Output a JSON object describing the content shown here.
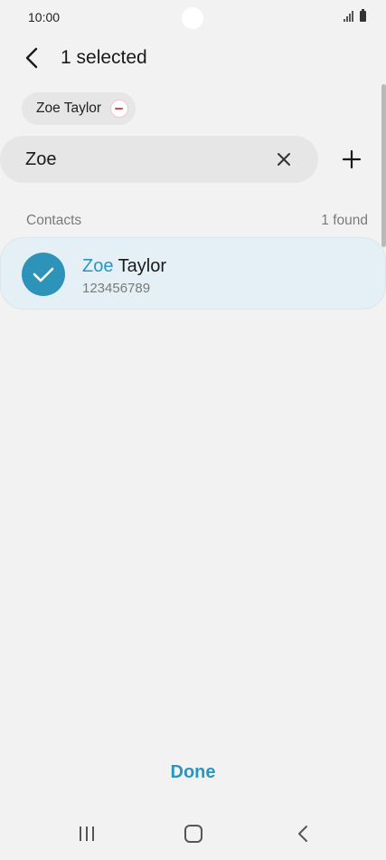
{
  "status_bar": {
    "time": "10:00"
  },
  "header": {
    "title": "1 selected"
  },
  "selected_chips": [
    {
      "label": "Zoe Taylor"
    }
  ],
  "search": {
    "value": "Zoe",
    "placeholder": ""
  },
  "section": {
    "label": "Contacts",
    "count": "1 found"
  },
  "contacts": [
    {
      "name_match": "Zoe",
      "name_rest": " Taylor",
      "number": "123456789",
      "selected": true
    }
  ],
  "footer": {
    "done_label": "Done"
  },
  "colors": {
    "accent": "#2896bf",
    "check_bg": "#2e93b8",
    "selected_row_bg": "#e4f0f5",
    "remove_red": "#e04747"
  },
  "icons": {
    "back": "back-arrow-icon",
    "remove": "minus-circle-icon",
    "clear": "close-icon",
    "add": "plus-icon",
    "check": "checkmark-icon",
    "signal": "signal-icon",
    "battery": "battery-icon"
  }
}
